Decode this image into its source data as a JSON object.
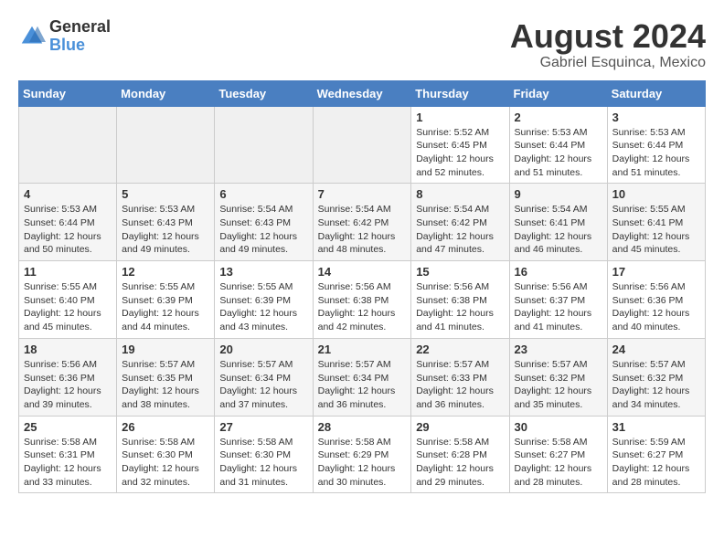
{
  "header": {
    "logo_general": "General",
    "logo_blue": "Blue",
    "month_year": "August 2024",
    "location": "Gabriel Esquinca, Mexico"
  },
  "days_of_week": [
    "Sunday",
    "Monday",
    "Tuesday",
    "Wednesday",
    "Thursday",
    "Friday",
    "Saturday"
  ],
  "weeks": [
    [
      {
        "day": "",
        "info": ""
      },
      {
        "day": "",
        "info": ""
      },
      {
        "day": "",
        "info": ""
      },
      {
        "day": "",
        "info": ""
      },
      {
        "day": "1",
        "info": "Sunrise: 5:52 AM\nSunset: 6:45 PM\nDaylight: 12 hours\nand 52 minutes."
      },
      {
        "day": "2",
        "info": "Sunrise: 5:53 AM\nSunset: 6:44 PM\nDaylight: 12 hours\nand 51 minutes."
      },
      {
        "day": "3",
        "info": "Sunrise: 5:53 AM\nSunset: 6:44 PM\nDaylight: 12 hours\nand 51 minutes."
      }
    ],
    [
      {
        "day": "4",
        "info": "Sunrise: 5:53 AM\nSunset: 6:44 PM\nDaylight: 12 hours\nand 50 minutes."
      },
      {
        "day": "5",
        "info": "Sunrise: 5:53 AM\nSunset: 6:43 PM\nDaylight: 12 hours\nand 49 minutes."
      },
      {
        "day": "6",
        "info": "Sunrise: 5:54 AM\nSunset: 6:43 PM\nDaylight: 12 hours\nand 49 minutes."
      },
      {
        "day": "7",
        "info": "Sunrise: 5:54 AM\nSunset: 6:42 PM\nDaylight: 12 hours\nand 48 minutes."
      },
      {
        "day": "8",
        "info": "Sunrise: 5:54 AM\nSunset: 6:42 PM\nDaylight: 12 hours\nand 47 minutes."
      },
      {
        "day": "9",
        "info": "Sunrise: 5:54 AM\nSunset: 6:41 PM\nDaylight: 12 hours\nand 46 minutes."
      },
      {
        "day": "10",
        "info": "Sunrise: 5:55 AM\nSunset: 6:41 PM\nDaylight: 12 hours\nand 45 minutes."
      }
    ],
    [
      {
        "day": "11",
        "info": "Sunrise: 5:55 AM\nSunset: 6:40 PM\nDaylight: 12 hours\nand 45 minutes."
      },
      {
        "day": "12",
        "info": "Sunrise: 5:55 AM\nSunset: 6:39 PM\nDaylight: 12 hours\nand 44 minutes."
      },
      {
        "day": "13",
        "info": "Sunrise: 5:55 AM\nSunset: 6:39 PM\nDaylight: 12 hours\nand 43 minutes."
      },
      {
        "day": "14",
        "info": "Sunrise: 5:56 AM\nSunset: 6:38 PM\nDaylight: 12 hours\nand 42 minutes."
      },
      {
        "day": "15",
        "info": "Sunrise: 5:56 AM\nSunset: 6:38 PM\nDaylight: 12 hours\nand 41 minutes."
      },
      {
        "day": "16",
        "info": "Sunrise: 5:56 AM\nSunset: 6:37 PM\nDaylight: 12 hours\nand 41 minutes."
      },
      {
        "day": "17",
        "info": "Sunrise: 5:56 AM\nSunset: 6:36 PM\nDaylight: 12 hours\nand 40 minutes."
      }
    ],
    [
      {
        "day": "18",
        "info": "Sunrise: 5:56 AM\nSunset: 6:36 PM\nDaylight: 12 hours\nand 39 minutes."
      },
      {
        "day": "19",
        "info": "Sunrise: 5:57 AM\nSunset: 6:35 PM\nDaylight: 12 hours\nand 38 minutes."
      },
      {
        "day": "20",
        "info": "Sunrise: 5:57 AM\nSunset: 6:34 PM\nDaylight: 12 hours\nand 37 minutes."
      },
      {
        "day": "21",
        "info": "Sunrise: 5:57 AM\nSunset: 6:34 PM\nDaylight: 12 hours\nand 36 minutes."
      },
      {
        "day": "22",
        "info": "Sunrise: 5:57 AM\nSunset: 6:33 PM\nDaylight: 12 hours\nand 36 minutes."
      },
      {
        "day": "23",
        "info": "Sunrise: 5:57 AM\nSunset: 6:32 PM\nDaylight: 12 hours\nand 35 minutes."
      },
      {
        "day": "24",
        "info": "Sunrise: 5:57 AM\nSunset: 6:32 PM\nDaylight: 12 hours\nand 34 minutes."
      }
    ],
    [
      {
        "day": "25",
        "info": "Sunrise: 5:58 AM\nSunset: 6:31 PM\nDaylight: 12 hours\nand 33 minutes."
      },
      {
        "day": "26",
        "info": "Sunrise: 5:58 AM\nSunset: 6:30 PM\nDaylight: 12 hours\nand 32 minutes."
      },
      {
        "day": "27",
        "info": "Sunrise: 5:58 AM\nSunset: 6:30 PM\nDaylight: 12 hours\nand 31 minutes."
      },
      {
        "day": "28",
        "info": "Sunrise: 5:58 AM\nSunset: 6:29 PM\nDaylight: 12 hours\nand 30 minutes."
      },
      {
        "day": "29",
        "info": "Sunrise: 5:58 AM\nSunset: 6:28 PM\nDaylight: 12 hours\nand 29 minutes."
      },
      {
        "day": "30",
        "info": "Sunrise: 5:58 AM\nSunset: 6:27 PM\nDaylight: 12 hours\nand 28 minutes."
      },
      {
        "day": "31",
        "info": "Sunrise: 5:59 AM\nSunset: 6:27 PM\nDaylight: 12 hours\nand 28 minutes."
      }
    ]
  ]
}
